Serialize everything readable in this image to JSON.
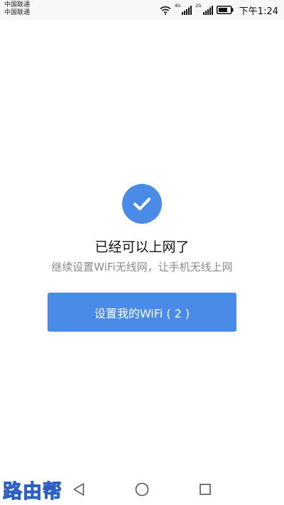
{
  "status_bar": {
    "carrier_1": "中国联通",
    "carrier_2": "中国联通",
    "network_1": "4G",
    "network_2": "2G",
    "time": "下午1:24",
    "icons": [
      "wifi-icon",
      "signal-icon",
      "signal-icon",
      "battery-icon"
    ]
  },
  "main": {
    "status_icon": "check-icon",
    "title": "已经可以上网了",
    "subtitle": "继续设置WiFi无线网，让手机无线上网",
    "button_label": "设置我的WiFi ( 2 )",
    "accent_color": "#4a8be8"
  },
  "nav_bar": {
    "watermark": "路由帮",
    "icons": [
      "back-icon",
      "home-icon",
      "recent-apps-icon"
    ]
  }
}
